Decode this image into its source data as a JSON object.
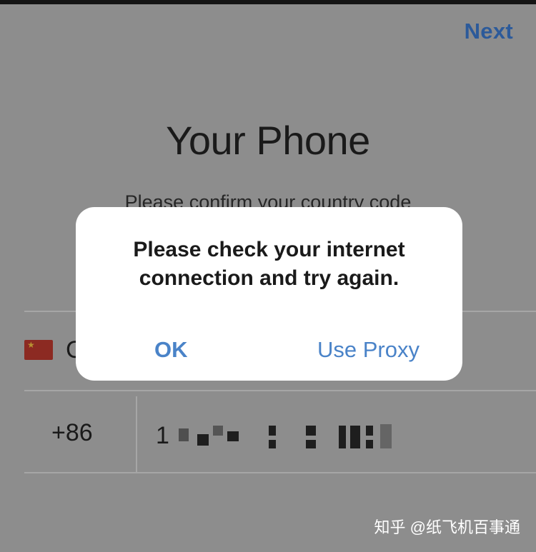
{
  "header": {
    "next_label": "Next"
  },
  "main": {
    "title": "Your Phone",
    "subtitle": "Please confirm your country code"
  },
  "form": {
    "country_flag": "china-flag-icon",
    "country_initial": "C",
    "country_code": "+86",
    "phone_prefix": "1"
  },
  "dialog": {
    "message": "Please check your internet connection and try again.",
    "ok_label": "OK",
    "proxy_label": "Use Proxy"
  },
  "watermark": {
    "text": "知乎 @纸飞机百事通"
  },
  "colors": {
    "accent": "#4a83c8",
    "link_dimmed": "#2c5a9a",
    "overlay_bg": "#8d8d8d",
    "dialog_bg": "#ffffff"
  }
}
